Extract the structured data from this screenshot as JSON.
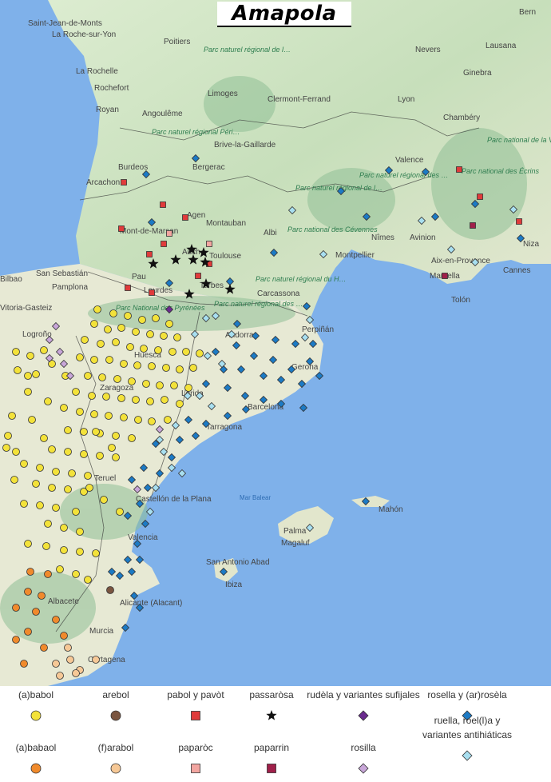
{
  "title": "Amapola",
  "map": {
    "sea_label": "Mar Balear",
    "places": [
      "Saint-Jean-de-Monts",
      "La Roche-sur-Yon",
      "Poitiers",
      "Parc naturel régional de la Brenne",
      "Nevers",
      "Bern",
      "Lausana",
      "La Rochelle",
      "Rochefort",
      "Royan",
      "Angoulême",
      "Limoges",
      "Clermont-Ferrand",
      "Lyon",
      "Ginebra",
      "Chambéry",
      "Parc naturel régional Périgord Limousin",
      "Brive-la-Gaillarde",
      "Valence",
      "Parc national de la Vanoise",
      "Bergerac",
      "Burdeos",
      "Arcachon",
      "Parc national des Écrins",
      "Agen",
      "Montauban",
      "Albi",
      "Parc naturel régional de l'Aubrac",
      "Parc naturel régional des Monts d'Ardèche",
      "Parc national des Cévennes",
      "Nîmes",
      "Avinion",
      "Auch",
      "Toulouse",
      "Niza",
      "Mont-de-Marsan",
      "Montpellier",
      "Aix-en-Provence",
      "Cannes",
      "Pau",
      "Tarbes",
      "Lourdes",
      "Parc naturel régional du Haut-Languedoc",
      "Marsella",
      "Tolón",
      "Carcassona",
      "Parc naturel régional des Pyrénées Ariégeoises",
      "Parc National des Pyrénées",
      "Bilbao",
      "San Sebastián",
      "Vitoria-Gasteiz",
      "Pamplona",
      "Logroño",
      "Andorra",
      "Perpiñán",
      "Huesca",
      "Gerona",
      "Zaragoza",
      "Lérida",
      "Barcelona",
      "Tarragona",
      "Teruel",
      "Castellón de la Plana",
      "Valencia",
      "Palma",
      "Magaluf",
      "Mahón",
      "Ibiza",
      "San Antonio Abad",
      "Albacete",
      "Alicante (Alacant)",
      "Murcia",
      "Cartagena"
    ],
    "yellow": "#f3e23a",
    "blue": "#1c7ac4"
  },
  "legend": [
    {
      "label": "(a)babol",
      "shape": "circle",
      "color": "#f3e23a"
    },
    {
      "label": "arebol",
      "shape": "circle",
      "color": "#7a5540"
    },
    {
      "label": "pabol y pavòt",
      "shape": "square",
      "color": "#e03b3b"
    },
    {
      "label": "passaròsa",
      "shape": "star",
      "color": "#111111"
    },
    {
      "label": "rudèla y variantes sufijales",
      "shape": "diamond",
      "color": "#6a2b8e"
    },
    {
      "label": "rosella y (ar)rosèla",
      "shape": "diamond",
      "color": "#1c7ac4"
    },
    {
      "label": "(a)babaol",
      "shape": "circle",
      "color": "#f08a2c"
    },
    {
      "label": "(f)arabol",
      "shape": "circle",
      "color": "#f6c896"
    },
    {
      "label": "paparòc",
      "shape": "square",
      "color": "#f2a5a0"
    },
    {
      "label": "paparrin",
      "shape": "square",
      "color": "#a0204a"
    },
    {
      "label": "rosilla",
      "shape": "diamond",
      "color": "#c8a6d8"
    },
    {
      "label": "ruella, roel(l)a y\nvariantes antihiáticas",
      "shape": "diamond",
      "color": "#a8dff0"
    }
  ]
}
